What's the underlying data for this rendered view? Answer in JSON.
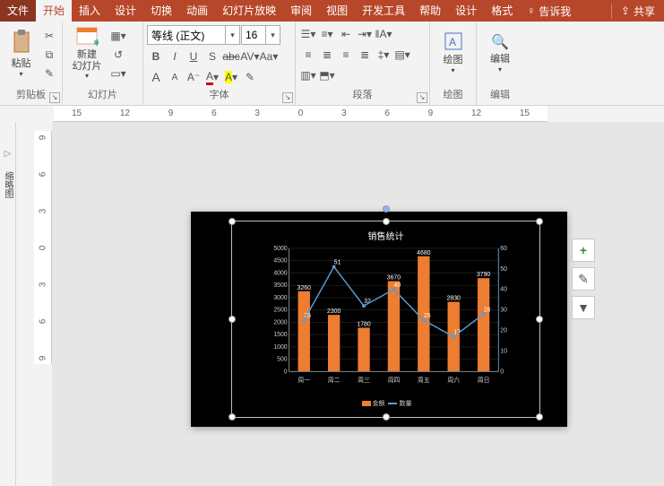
{
  "tabs": {
    "file": "文件",
    "home": "开始",
    "insert": "插入",
    "design": "设计",
    "transitions": "切换",
    "animations": "动画",
    "slideshow": "幻灯片放映",
    "review": "审阅",
    "view": "视图",
    "devtools": "开发工具",
    "help": "帮助",
    "design2": "设计",
    "format": "格式",
    "tellme": "告诉我",
    "share": "共享"
  },
  "groups": {
    "clipboard": "剪贴板",
    "slides": "幻灯片",
    "font": "字体",
    "paragraph": "段落",
    "drawing": "绘图",
    "editing": "编辑"
  },
  "buttons": {
    "paste": "粘贴",
    "newslide": "新建\n幻灯片",
    "draw": "绘图",
    "edit": "编辑"
  },
  "font": {
    "name": "等线 (正文)",
    "size": "16",
    "bold": "B",
    "italic": "I",
    "underline": "U",
    "strike": "S",
    "charspace": "AV",
    "clearfmt": "Aₐ",
    "grow": "A",
    "shrink": "A",
    "color": "A",
    "highlight": "A"
  },
  "ruler_h": [
    "15",
    "12",
    "9",
    "6",
    "3",
    "0",
    "3",
    "6",
    "9",
    "12",
    "15"
  ],
  "ruler_v": [
    "9",
    "6",
    "3",
    "0",
    "3",
    "6",
    "9"
  ],
  "outline": {
    "collapse": "▷",
    "label": "缩略图"
  },
  "chart_data": {
    "type": "bar+line",
    "title": "销售统计",
    "categories": [
      "周一",
      "周二",
      "周三",
      "周四",
      "周五",
      "周六",
      "周日"
    ],
    "series": [
      {
        "name": "金额",
        "type": "bar",
        "values": [
          3260,
          2300,
          1780,
          3670,
          4680,
          2830,
          3790
        ],
        "axis": "left"
      },
      {
        "name": "数量",
        "type": "line",
        "values": [
          25,
          51,
          32,
          40,
          25,
          17,
          28
        ],
        "axis": "right",
        "point_labels": [
          "25",
          "51",
          "32",
          "40",
          "25",
          "17",
          "28"
        ]
      }
    ],
    "y_left": {
      "min": 0,
      "max": 5000,
      "ticks": [
        0,
        500,
        1000,
        1500,
        2000,
        2500,
        3000,
        3500,
        4000,
        4500,
        5000
      ]
    },
    "y_right": {
      "min": 0,
      "max": 60,
      "ticks": [
        0,
        10,
        20,
        30,
        40,
        50,
        60
      ]
    },
    "legend": [
      "金额",
      "数量"
    ]
  },
  "sidebtns": {
    "add": "+",
    "brush": "✎",
    "filter": "▼"
  }
}
